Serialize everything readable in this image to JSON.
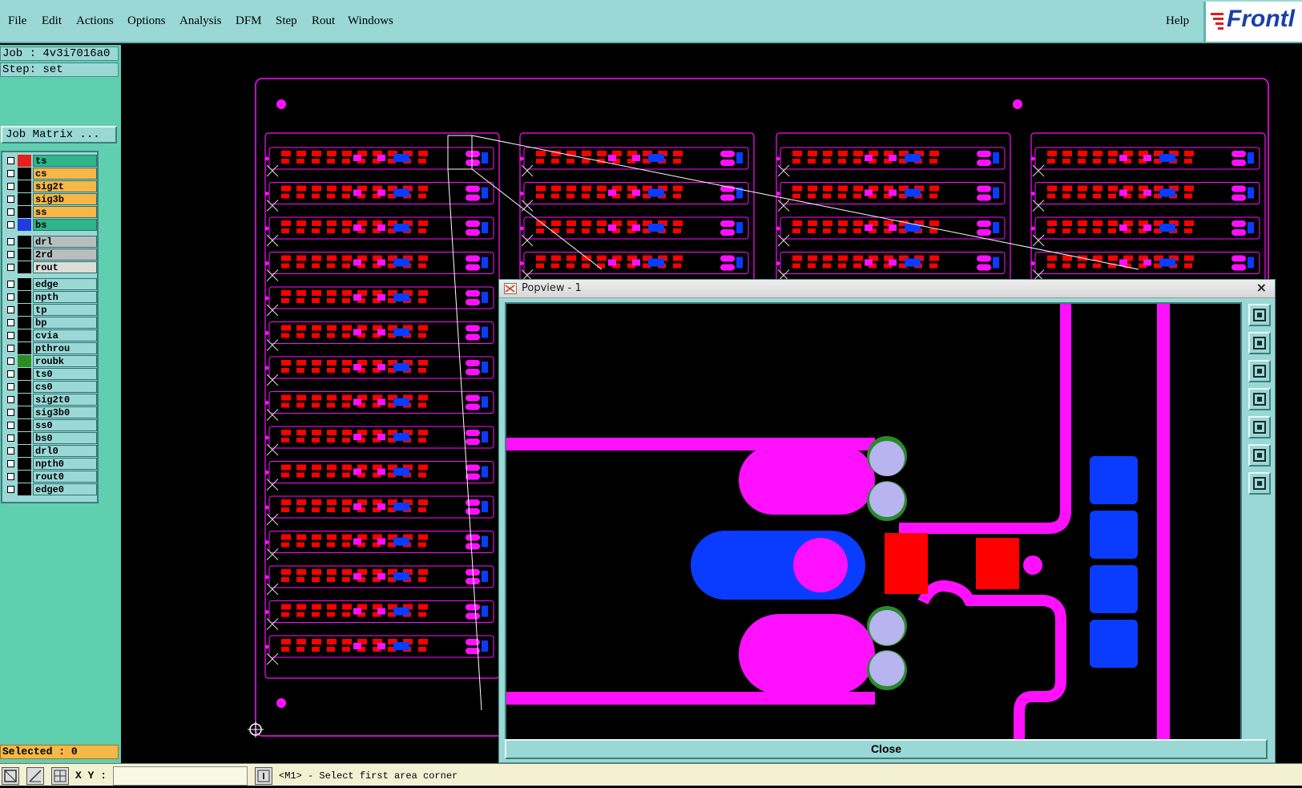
{
  "menu": [
    "File",
    "Edit",
    "Actions",
    "Options",
    "Analysis",
    "DFM",
    "Step",
    "Rout",
    "Windows"
  ],
  "help_label": "Help",
  "logo_text": "Frontl",
  "job_label": "Job : 4v3i7016a0",
  "step_label": "Step: set",
  "job_matrix_label": "Job Matrix ...",
  "layers": [
    {
      "name": "ts",
      "color": "#e8201c",
      "bg": "#2fb58a"
    },
    {
      "name": "cs",
      "color": "#000000",
      "bg": "#f5b747"
    },
    {
      "name": "sig2t",
      "color": "#000000",
      "bg": "#f5b747"
    },
    {
      "name": "sig3b",
      "color": "#000000",
      "bg": "#f5b747"
    },
    {
      "name": "ss",
      "color": "#000000",
      "bg": "#f5b747"
    },
    {
      "name": "bs",
      "color": "#1f3ce0",
      "bg": "#2fb58a"
    },
    {
      "name": "drl",
      "color": "#000000",
      "bg": "#b9bdbd"
    },
    {
      "name": "2rd",
      "color": "#000000",
      "bg": "#b9bdbd"
    },
    {
      "name": "rout",
      "color": "#000000",
      "bg": "#dcdcd8"
    },
    {
      "name": "edge",
      "color": "#000000",
      "bg": "#9ad8d6"
    },
    {
      "name": "npth",
      "color": "#000000",
      "bg": "#9ad8d6"
    },
    {
      "name": "tp",
      "color": "#000000",
      "bg": "#9ad8d6"
    },
    {
      "name": "bp",
      "color": "#000000",
      "bg": "#9ad8d6"
    },
    {
      "name": "cvia",
      "color": "#000000",
      "bg": "#9ad8d6"
    },
    {
      "name": "pthrou",
      "color": "#000000",
      "bg": "#9ad8d6"
    },
    {
      "name": "roubk",
      "color": "#2e8b22",
      "bg": "#9ad8d6"
    },
    {
      "name": "ts0",
      "color": "#000000",
      "bg": "#9ad8d6"
    },
    {
      "name": "cs0",
      "color": "#000000",
      "bg": "#9ad8d6"
    },
    {
      "name": "sig2t0",
      "color": "#000000",
      "bg": "#9ad8d6"
    },
    {
      "name": "sig3b0",
      "color": "#000000",
      "bg": "#9ad8d6"
    },
    {
      "name": "ss0",
      "color": "#000000",
      "bg": "#9ad8d6"
    },
    {
      "name": "bs0",
      "color": "#000000",
      "bg": "#9ad8d6"
    },
    {
      "name": "drl0",
      "color": "#000000",
      "bg": "#9ad8d6"
    },
    {
      "name": "npth0",
      "color": "#000000",
      "bg": "#9ad8d6"
    },
    {
      "name": "rout0",
      "color": "#000000",
      "bg": "#9ad8d6"
    },
    {
      "name": "edge0",
      "color": "#000000",
      "bg": "#9ad8d6"
    }
  ],
  "selected_label": "Selected : 0",
  "xy_label": "X Y :",
  "status_message": "<M1> - Select first area corner",
  "popview": {
    "title": "Popview - 1",
    "close_label": "Close",
    "tools": [
      "zoom-fit-icon",
      "pan-up-icon",
      "pan-down-icon",
      "pan-left-icon",
      "pan-right-icon",
      "zoom-extents-icon",
      "zoom-center-icon"
    ]
  },
  "colors": {
    "copper": "#ff10ff",
    "pad": "#ff0000",
    "bottom": "#0a3cff",
    "hole": "#b7b4f0",
    "ring": "#2a8a2a",
    "panel_bg": "#5fcfb0",
    "menu_bg": "#9ad8d6"
  }
}
